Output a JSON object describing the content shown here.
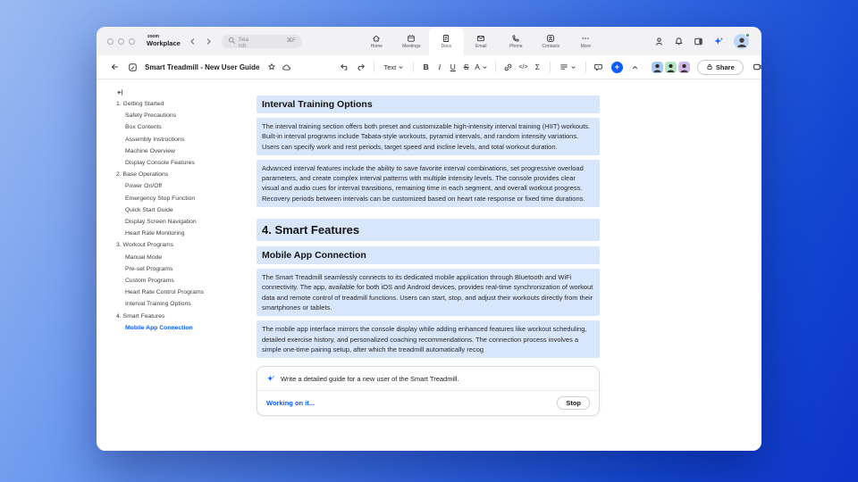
{
  "titlebar": {
    "brand_line1": "zoom",
    "brand_line2": "Workplace",
    "search_placeholder": "Search",
    "search_shortcut": "⌘F",
    "tabs": [
      {
        "label": "Home"
      },
      {
        "label": "Meetings"
      },
      {
        "label": "Docs"
      },
      {
        "label": "Email"
      },
      {
        "label": "Phone"
      },
      {
        "label": "Contacts"
      },
      {
        "label": "More"
      }
    ]
  },
  "toolbar": {
    "doc_title": "Smart Treadmill - New User Guide",
    "text_style": "Text",
    "bold": "B",
    "italic": "I",
    "underline": "U",
    "strikethrough": "S",
    "font_color": "A",
    "code": "</>",
    "formula": "Σ",
    "more": "⋯",
    "share": "Share"
  },
  "sidebar": {
    "items": [
      {
        "label": "1. Getting Started",
        "level": 0,
        "active": false
      },
      {
        "label": "Safety Precautions",
        "level": 1,
        "active": false
      },
      {
        "label": "Box Contents",
        "level": 1,
        "active": false
      },
      {
        "label": "Assembly Instructions",
        "level": 1,
        "active": false
      },
      {
        "label": "Machine Overview",
        "level": 1,
        "active": false
      },
      {
        "label": "Display Console Features",
        "level": 1,
        "active": false
      },
      {
        "label": "2. Base Operations",
        "level": 0,
        "active": false
      },
      {
        "label": "Power On/Off",
        "level": 1,
        "active": false
      },
      {
        "label": "Emergency Stop Function",
        "level": 1,
        "active": false
      },
      {
        "label": "Quick Start Guide",
        "level": 1,
        "active": false
      },
      {
        "label": "Display Screen Navigation",
        "level": 1,
        "active": false
      },
      {
        "label": "Heart Rate Monitoring",
        "level": 1,
        "active": false
      },
      {
        "label": "3. Workout Programs",
        "level": 0,
        "active": false
      },
      {
        "label": "Manual Mode",
        "level": 1,
        "active": false
      },
      {
        "label": "Pre-set Programs",
        "level": 1,
        "active": false
      },
      {
        "label": "Custom Programs",
        "level": 1,
        "active": false
      },
      {
        "label": "Heart Rate Control Programs",
        "level": 1,
        "active": false
      },
      {
        "label": "Interval Training Options",
        "level": 1,
        "active": false
      },
      {
        "label": "4. Smart Features",
        "level": 0,
        "active": false
      },
      {
        "label": "Mobile App Connection",
        "level": 1,
        "active": true
      }
    ]
  },
  "document": {
    "blocks": [
      {
        "type": "h2",
        "text": "Interval Training Options"
      },
      {
        "type": "p",
        "text": "The interval training section offers both preset and customizable high-intensity interval training (HIIT) workouts. Built-in interval programs include Tabata-style workouts, pyramid intervals, and random intensity variations. Users can specify work and rest periods, target speed and incline levels, and total workout duration."
      },
      {
        "type": "p",
        "text": "Advanced interval features include the ability to save favorite interval combinations, set progressive overload parameters, and create complex interval patterns with multiple intensity levels. The console provides clear visual and audio cues for interval transitions, remaining time in each segment, and overall workout progress. Recovery periods between intervals can be customized based on heart rate response or fixed time durations."
      },
      {
        "type": "h1",
        "text": "4. Smart Features"
      },
      {
        "type": "h2",
        "text": "Mobile App Connection"
      },
      {
        "type": "p",
        "text": "The Smart Treadmill seamlessly connects to its dedicated mobile application through Bluetooth and WiFi connectivity. The app, available for both iOS and Android devices, provides real-time synchronization of workout data and remote control of treadmill functions. Users can start, stop, and adjust their workouts directly from their smartphones or tablets."
      },
      {
        "type": "p",
        "text": "The mobile app interface mirrors the console display while adding enhanced features like workout scheduling, detailed exercise history, and personalized coaching recommendations. The connection process involves a simple one-time pairing setup, after which the treadmill automatically recog"
      }
    ]
  },
  "ai_panel": {
    "prompt": "Write a detailed guide for a new user of the Smart Treadmill.",
    "status": "Working on it...",
    "stop": "Stop"
  },
  "colors": {
    "accent": "#0b5cff",
    "highlight": "#d7e6fb",
    "background_gradient_start": "#9abaf1",
    "background_gradient_end": "#0e33c8",
    "presence_green": "#27a343"
  }
}
